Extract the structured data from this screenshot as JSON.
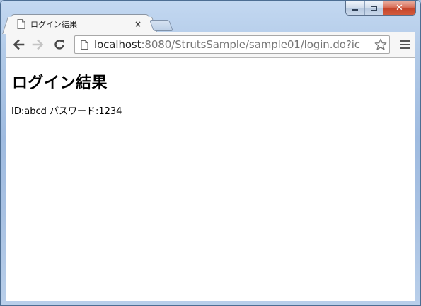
{
  "tab": {
    "title": "ログイン結果",
    "close_glyph": "×"
  },
  "address_bar": {
    "host": "localhost",
    "rest": ":8080/StrutsSample/sample01/login.do?ic"
  },
  "page": {
    "heading": "ログイン結果",
    "result_text": "ID:abcd  パスワード:1234"
  },
  "window_controls": {
    "close_glyph": "✕"
  },
  "icons": {
    "back": "back-arrow-icon",
    "forward": "forward-arrow-icon",
    "reload": "reload-icon",
    "star": "bookmark-star-icon",
    "menu": "hamburger-menu-icon",
    "page": "page-icon"
  },
  "colors": {
    "frame": "#a9c2e0",
    "toolbar": "#f6f6f6",
    "close_button": "#c4442a"
  }
}
